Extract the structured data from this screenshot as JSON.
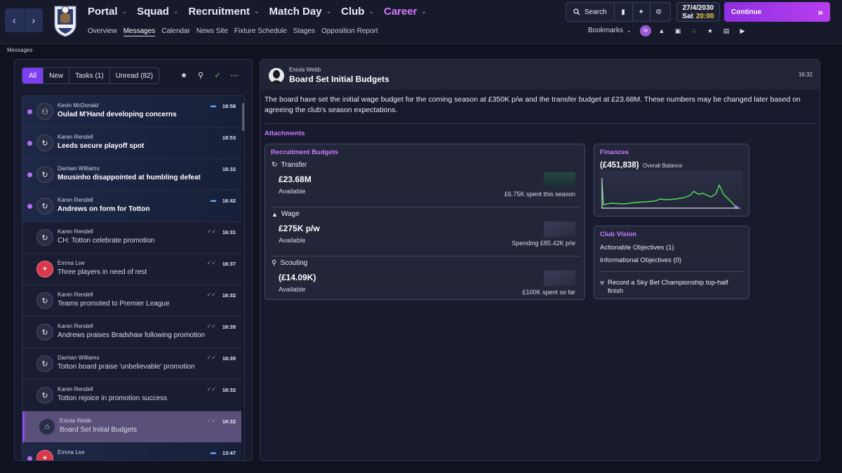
{
  "colors": {
    "accent": "#8e2fe0",
    "career": "#d57cff",
    "attachments": "#c97bff",
    "unread_dot": "#b46ef0",
    "time_highlight": "#f3d24a",
    "finance_line": "#54e05a"
  },
  "header": {
    "main_nav": [
      "Portal",
      "Squad",
      "Recruitment",
      "Match Day",
      "Club",
      "Career"
    ],
    "sub_nav": [
      "Overview",
      "Messages",
      "Calendar",
      "News Site",
      "Fixture Schedule",
      "Stages",
      "Opposition Report"
    ],
    "active_sub_nav": "Messages",
    "search_label": "Search",
    "date": "27/4/2030",
    "day": "Sat",
    "time": "20:00",
    "continue_label": "Continue",
    "bookmarks_label": "Bookmarks",
    "quick_icons": [
      "inbox-badge-icon",
      "kit-icon",
      "clipboard-icon",
      "tactics-icon",
      "trophy-icon",
      "notes-icon",
      "megaphone-icon"
    ]
  },
  "breadcrumb": "Messages",
  "messages_panel": {
    "filters": [
      "All",
      "New",
      "Tasks (1)",
      "Unread (82)"
    ],
    "active_filter": "All",
    "messages": [
      {
        "sender": "Kevin McDonald",
        "subject": "Oulad M'Hand developing concerns",
        "time": "18:58",
        "unread": true,
        "icon": "group-icon",
        "status": "chat"
      },
      {
        "sender": "Karen Rendell",
        "subject": "Leeds secure playoff spot",
        "time": "18:53",
        "unread": true,
        "icon": "news-icon",
        "status": ""
      },
      {
        "sender": "Damian Williams",
        "subject": "Mousinho disappointed at humbling defeat",
        "time": "16:32",
        "unread": true,
        "icon": "news-icon",
        "status": ""
      },
      {
        "sender": "Karen Rendell",
        "subject": "Andrews on form for Totton",
        "time": "16:42",
        "unread": true,
        "icon": "news-icon",
        "status": "chat"
      },
      {
        "sender": "Karen Rendell",
        "subject": "CH: Totton celebrate promotion",
        "time": "16:31",
        "unread": false,
        "icon": "news-icon",
        "status": "read"
      },
      {
        "sender": "Emma Lee",
        "subject": "Three players in need of rest",
        "time": "16:37",
        "unread": false,
        "icon": "medical-icon",
        "status": "read"
      },
      {
        "sender": "Karen Rendell",
        "subject": "Teams promoted to Premier League",
        "time": "16:32",
        "unread": false,
        "icon": "news-icon",
        "status": "read"
      },
      {
        "sender": "Karen Rendell",
        "subject": "Andrews praises Bradshaw following promotion",
        "time": "16:35",
        "unread": false,
        "icon": "news-icon",
        "status": "read"
      },
      {
        "sender": "Damian Williams",
        "subject": "Totton board praise 'unbelievable' promotion",
        "time": "16:35",
        "unread": false,
        "icon": "news-icon",
        "status": "read"
      },
      {
        "sender": "Karen Rendell",
        "subject": "Totton rejoice in promotion success",
        "time": "16:32",
        "unread": false,
        "icon": "news-icon",
        "status": "read"
      },
      {
        "sender": "Eniola Webb",
        "subject": "Board Set Initial Budgets",
        "time": "16:32",
        "unread": false,
        "icon": "board-icon",
        "status": "read",
        "selected": true
      },
      {
        "sender": "Emma Lee",
        "subject": "",
        "time": "13:47",
        "unread": true,
        "icon": "medical-icon",
        "status": "chat"
      }
    ]
  },
  "detail": {
    "sender": "Eniola Webb",
    "subject": "Board Set Initial Budgets",
    "time": "16:32",
    "body": "The board have set the initial wage budget for the coming season at £350K p/w and the transfer budget at £23.68M. These numbers may be changed later based on agreeing the club's season expectations.",
    "attachments_title": "Attachments",
    "recruitment": {
      "title": "Recruitment Budgets",
      "rows": [
        {
          "label": "Transfer",
          "icon": "refresh-icon",
          "value": "£23.68M",
          "sub": "Available",
          "note": "£6.75K spent this season"
        },
        {
          "label": "Wage",
          "icon": "shirt-icon",
          "value": "£275K p/w",
          "sub": "Available",
          "note": "Spending £85.42K p/w"
        },
        {
          "label": "Scouting",
          "icon": "magnifier-icon",
          "value": "(£14.09K)",
          "sub": "Available",
          "note": "£100K spent so far"
        }
      ]
    },
    "finances": {
      "title": "Finances",
      "value": "(£451,838)",
      "label": "Overall Balance"
    },
    "vision": {
      "title": "Club Vision",
      "actionable_label": "Actionable Objectives",
      "actionable_count": "(1)",
      "informational_label": "Informational Objectives",
      "informational_count": "(0)",
      "objective": "Record a Sky Bet Championship top-half finish"
    }
  }
}
